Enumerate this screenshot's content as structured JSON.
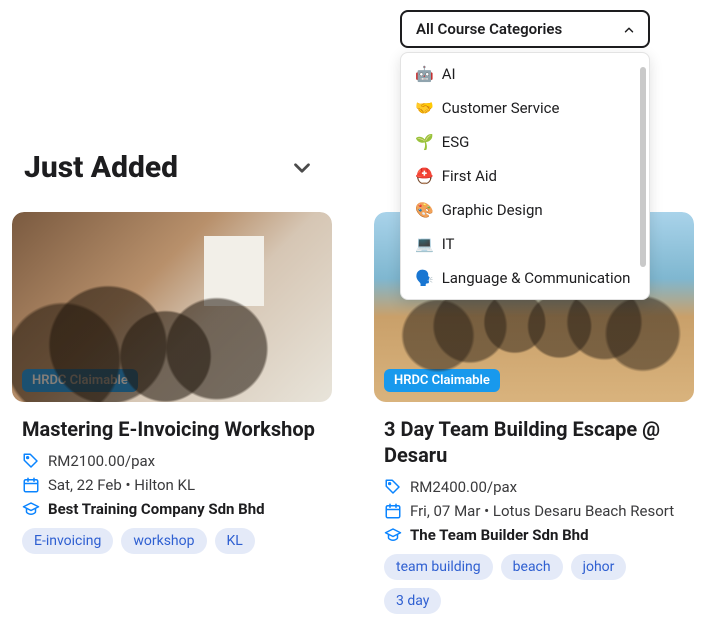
{
  "category_select": {
    "label": "All Course Categories",
    "options": [
      {
        "emoji": "🤖",
        "label": "AI"
      },
      {
        "emoji": "🤝",
        "label": "Customer Service"
      },
      {
        "emoji": "🌱",
        "label": "ESG"
      },
      {
        "emoji": "⛑️",
        "label": "First Aid"
      },
      {
        "emoji": "🎨",
        "label": "Graphic Design"
      },
      {
        "emoji": "💻",
        "label": "IT"
      },
      {
        "emoji": "🗣️",
        "label": "Language & Communication"
      }
    ]
  },
  "section_title": "Just Added",
  "cards": [
    {
      "badge": "HRDC Claimable",
      "title": "Mastering E-Invoicing Workshop",
      "price": "RM2100.00/pax",
      "date_location": "Sat, 22 Feb • Hilton KL",
      "provider": "Best Training Company Sdn Bhd",
      "tags": [
        "E-invoicing",
        "workshop",
        "KL"
      ]
    },
    {
      "badge": "HRDC Claimable",
      "title": "3 Day Team Building Escape @ Desaru",
      "price": "RM2400.00/pax",
      "date_location": "Fri, 07 Mar • Lotus Desaru Beach Resort",
      "provider": "The Team Builder Sdn Bhd",
      "tags": [
        "team building",
        "beach",
        "johor",
        "3 day"
      ]
    }
  ]
}
